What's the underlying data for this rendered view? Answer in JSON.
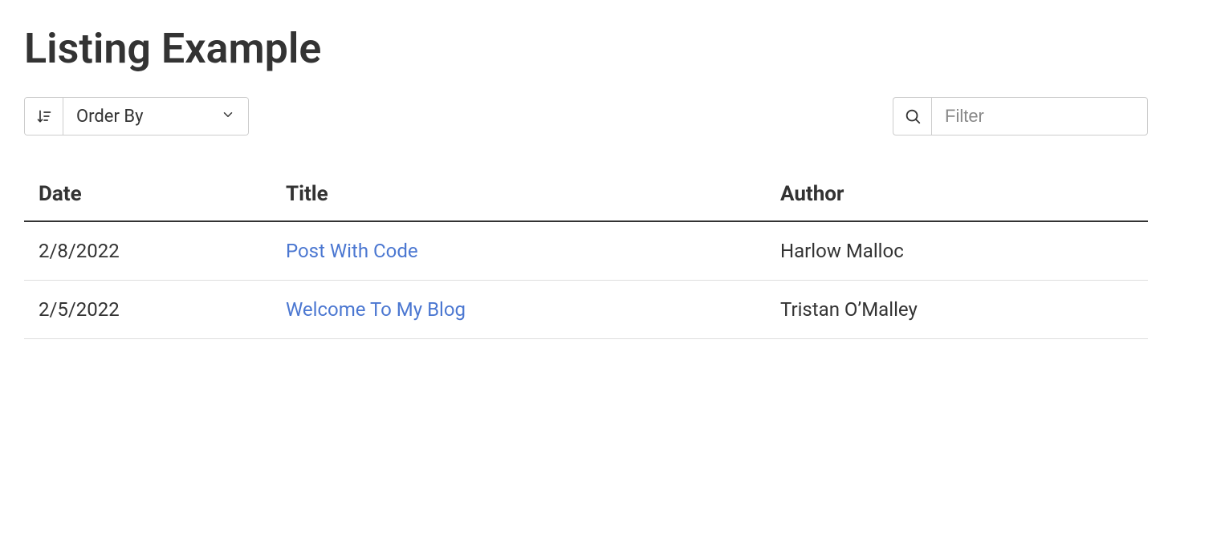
{
  "header": {
    "title": "Listing Example"
  },
  "toolbar": {
    "order_by_label": "Order By",
    "filter_placeholder": "Filter"
  },
  "table": {
    "headers": {
      "date": "Date",
      "title": "Title",
      "author": "Author"
    },
    "rows": [
      {
        "date": "2/8/2022",
        "title": "Post With Code",
        "author": "Harlow Malloc"
      },
      {
        "date": "2/5/2022",
        "title": "Welcome To My Blog",
        "author": "Tristan O’Malley"
      }
    ]
  }
}
